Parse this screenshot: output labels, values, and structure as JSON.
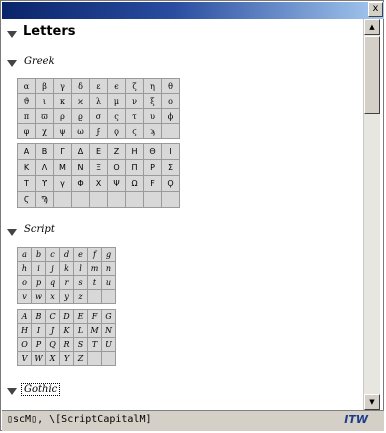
{
  "window": {
    "close_label": "x"
  },
  "section": {
    "title": "Letters",
    "subsections": {
      "greek": {
        "title": "Greek",
        "lowercase": [
          [
            "α",
            "β",
            "γ",
            "δ",
            "ε",
            "ϵ",
            "ζ",
            "η",
            "θ"
          ],
          [
            "ϑ",
            "ι",
            "κ",
            "ϰ",
            "λ",
            "μ",
            "ν",
            "ξ",
            "ο"
          ],
          [
            "π",
            "ϖ",
            "ρ",
            "ϱ",
            "σ",
            "ς",
            "τ",
            "υ",
            "ϕ"
          ],
          [
            "φ",
            "χ",
            "ψ",
            "ω",
            "ϝ",
            "ϙ",
            "ϛ",
            "ϡ",
            ""
          ]
        ],
        "uppercase": [
          [
            "Α",
            "Β",
            "Γ",
            "Δ",
            "Ε",
            "Ζ",
            "Η",
            "Θ",
            "Ι"
          ],
          [
            "Κ",
            "Λ",
            "Μ",
            "Ν",
            "Ξ",
            "Ο",
            "Π",
            "Ρ",
            "Σ"
          ],
          [
            "Τ",
            "ϒ",
            "γ",
            "Φ",
            "Χ",
            "Ψ",
            "Ω",
            "Ϝ",
            "Ϙ"
          ],
          [
            "Ϛ",
            "Ϡ",
            "",
            "",
            "",
            "",
            "",
            "",
            ""
          ]
        ]
      },
      "script": {
        "title": "Script",
        "lowercase": [
          [
            "a",
            "b",
            "c",
            "d",
            "e",
            "f",
            "g"
          ],
          [
            "h",
            "i",
            "j",
            "k",
            "l",
            "m",
            "n"
          ],
          [
            "o",
            "p",
            "q",
            "r",
            "s",
            "t",
            "u"
          ],
          [
            "v",
            "w",
            "x",
            "y",
            "z",
            "",
            ""
          ]
        ],
        "uppercase": [
          [
            "A",
            "B",
            "C",
            "D",
            "E",
            "F",
            "G"
          ],
          [
            "H",
            "I",
            "J",
            "K",
            "L",
            "M",
            "N"
          ],
          [
            "O",
            "P",
            "Q",
            "R",
            "S",
            "T",
            "U"
          ],
          [
            "V",
            "W",
            "X",
            "Y",
            "Z",
            "",
            ""
          ]
        ]
      },
      "gothic": {
        "title": "Gothic"
      }
    }
  },
  "statusbar": {
    "text": "▯scM▯, \\[ScriptCapitalM]",
    "logo": "ITW"
  },
  "scrollbar": {
    "up_arrow": "▲",
    "down_arrow": "▼"
  }
}
